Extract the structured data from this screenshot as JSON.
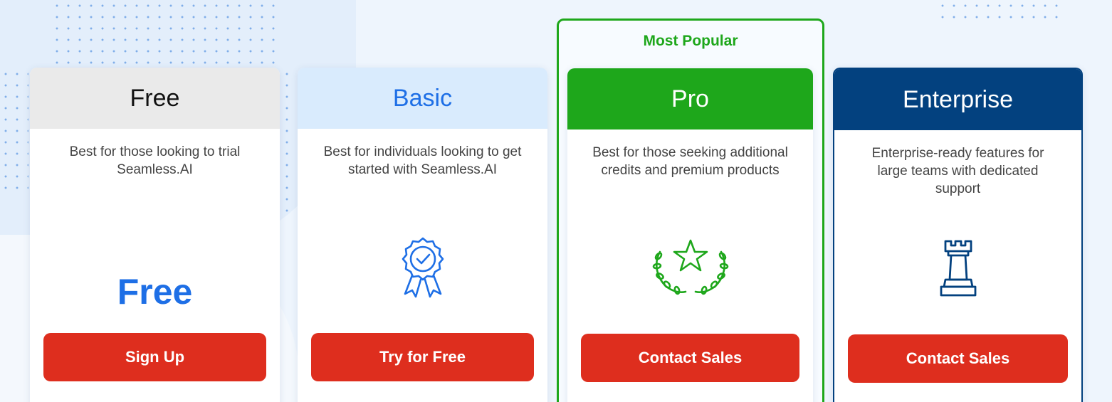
{
  "popular_label": "Most Popular",
  "plans": [
    {
      "id": "free",
      "name": "Free",
      "description": "Best for those looking to trial Seamless.AI",
      "price_text": "Free",
      "cta": "Sign Up",
      "header_bg": "#eaeaea",
      "header_color": "#111111"
    },
    {
      "id": "basic",
      "name": "Basic",
      "description": "Best for individuals looking to get started with Seamless.AI",
      "icon": "award-ribbon-icon",
      "cta": "Try for Free",
      "header_bg": "#d9ebfd",
      "header_color": "#1e6fe6"
    },
    {
      "id": "pro",
      "name": "Pro",
      "description": "Best for those seeking additional credits and premium products",
      "icon": "star-laurel-icon",
      "cta": "Contact Sales",
      "header_bg": "#1ea71b",
      "header_color": "#ffffff"
    },
    {
      "id": "enterprise",
      "name": "Enterprise",
      "description": "Enterprise-ready features for large teams with dedicated support",
      "icon": "chess-rook-icon",
      "cta": "Contact Sales",
      "header_bg": "#03417f",
      "header_color": "#ffffff"
    }
  ],
  "colors": {
    "cta": "#de2e1e",
    "accent_blue": "#1e6fe6",
    "accent_green": "#1ea71b",
    "enterprise_navy": "#03417f"
  }
}
